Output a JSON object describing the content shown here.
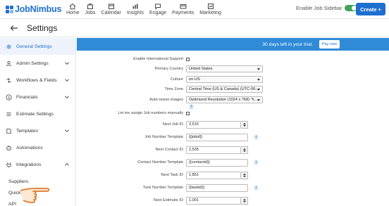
{
  "brand": {
    "name": "JobNimbus",
    "color": "#1f6fd1"
  },
  "nav": [
    {
      "label": "Home",
      "icon": "home-icon"
    },
    {
      "label": "Jobs",
      "icon": "jobs-icon"
    },
    {
      "label": "Calendar",
      "icon": "calendar-icon"
    },
    {
      "label": "Insights",
      "icon": "insights-icon"
    },
    {
      "label": "Engage",
      "icon": "engage-icon"
    },
    {
      "label": "Payments",
      "icon": "payments-icon"
    },
    {
      "label": "Marketing",
      "icon": "marketing-icon"
    }
  ],
  "header": {
    "sidebar_toggle_label": "Enable Job Sidebar",
    "sidebar_toggle_on": true,
    "create_label": "Create +"
  },
  "page": {
    "title": "Settings"
  },
  "sidebar": {
    "items": [
      {
        "label": "General Settings",
        "icon": "gear-icon",
        "active": true
      },
      {
        "label": "Admin Settings",
        "icon": "user-icon"
      },
      {
        "label": "Workflows & Fields",
        "icon": "workflow-icon"
      },
      {
        "label": "Financials",
        "icon": "dollar-icon"
      },
      {
        "label": "Estimate Settings",
        "icon": "list-icon"
      },
      {
        "label": "Templates",
        "icon": "template-icon"
      },
      {
        "label": "Automations",
        "icon": "automation-icon"
      },
      {
        "label": "Integrations",
        "icon": "integration-icon"
      }
    ],
    "sub_items": [
      "Suppliers",
      "QuickBooks",
      "API"
    ]
  },
  "trial": {
    "text": "30 days left in your trial.",
    "pay_label": "Pay now",
    "bar_color": "#2f8bd8"
  },
  "form": {
    "international_label": "Enable International Support",
    "primary_country_label": "Primary Country",
    "primary_country_value": "United States",
    "culture_label": "Culture",
    "culture_value": "en-US",
    "timezone_label": "Time Zone",
    "timezone_value": "Central Time (US & Canada) (UTC-06:...",
    "autoresize_label": "Auto-resize images",
    "autoresize_value": "Optimized Resolution (1024 x 768) \"h...",
    "assign_numbers_label": "Let me assign Job numbers manually",
    "next_job_label": "Next Job ID",
    "next_job_value": "2,515",
    "job_template_label": "Job Number Template",
    "job_template_value": "{{jobid}}",
    "next_contact_label": "Next Contact ID",
    "next_contact_value": "2,535",
    "contact_template_label": "Contact Number Template",
    "contact_template_value": "{{contactid}}",
    "next_task_label": "Next Task ID",
    "next_task_value": "1,851",
    "task_template_label": "Task Number Template",
    "task_template_value": "{{taskid}}",
    "next_estimate_label": "Next Estimate ID",
    "next_estimate_value": "1,001"
  }
}
